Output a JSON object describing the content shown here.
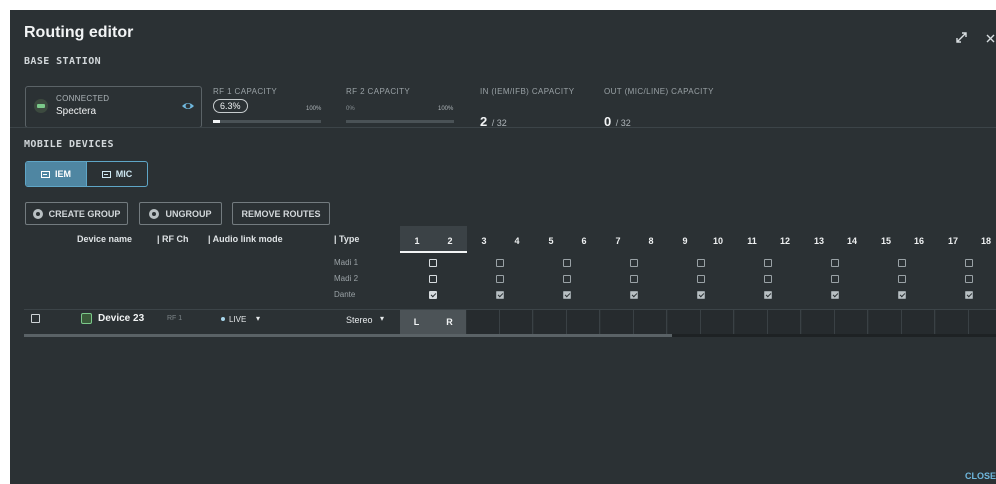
{
  "dialog": {
    "title": "Routing editor",
    "close_label": "CLOSE"
  },
  "base_station": {
    "section_label": "BASE STATION",
    "status": "CONNECTED",
    "name": "Spectera",
    "rf1": {
      "label": "RF 1 CAPACITY",
      "value_text": "6.3%",
      "value_fraction": 0.063,
      "max_label": "100%"
    },
    "rf2": {
      "label": "RF 2 CAPACITY",
      "min_label": "0%",
      "max_label": "100%",
      "value_fraction": 0
    },
    "in_cap": {
      "label": "IN (IEM/IFB) CAPACITY",
      "value": "2",
      "total": "/ 32"
    },
    "out_cap": {
      "label": "OUT (MIC/LINE) CAPACITY",
      "value": "0",
      "total": "/ 32"
    }
  },
  "mobile_devices": {
    "section_label": "MOBILE DEVICES",
    "tabs": [
      {
        "label": "IEM",
        "active": true
      },
      {
        "label": "MIC",
        "active": false
      }
    ],
    "actions": {
      "create_group": "CREATE GROUP",
      "ungroup": "UNGROUP",
      "remove_routes": "REMOVE ROUTES"
    }
  },
  "table": {
    "headers": {
      "device_name": "Device name",
      "rf_ch": "| RF Ch",
      "audio_link_mode": "| Audio link mode",
      "type": "| Type"
    },
    "channels": [
      "1",
      "2",
      "3",
      "4",
      "5",
      "6",
      "7",
      "8",
      "9",
      "10",
      "11",
      "12",
      "13",
      "14",
      "15",
      "16",
      "17",
      "18"
    ],
    "networks": [
      {
        "label": "Madi 1",
        "checked": false
      },
      {
        "label": "Madi 2",
        "checked": false
      },
      {
        "label": "Dante",
        "checked": true
      }
    ],
    "rows": [
      {
        "name": "Device 23",
        "rf_ch": "RF 1",
        "audio_link_mode": "LIVE",
        "type": "Stereo",
        "left": "L",
        "right": "R"
      }
    ]
  },
  "colors": {
    "background": "#2b3134",
    "accent": "#5fa6c7",
    "active_tab": "#4f86a2",
    "close_link": "#6fb7dd"
  },
  "icons": [
    "expand-icon",
    "close-icon",
    "eye-icon",
    "group-icon",
    "device-icon",
    "chevron-down-icon"
  ]
}
